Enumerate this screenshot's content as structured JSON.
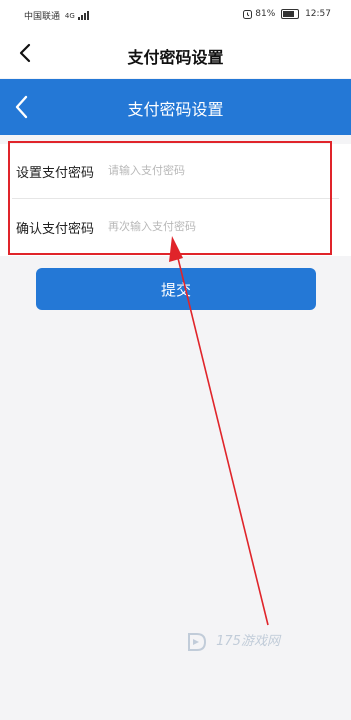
{
  "status_bar": {
    "carrier": "中国联通",
    "network": "4G",
    "battery": "81%",
    "time": "12:57"
  },
  "header": {
    "title": "支付密码设置"
  },
  "inner_header": {
    "title": "支付密码设置"
  },
  "form": {
    "set_password_label": "设置支付密码",
    "set_password_placeholder": "请输入支付密码",
    "confirm_password_label": "确认支付密码",
    "confirm_password_placeholder": "再次输入支付密码"
  },
  "submit_label": "提交",
  "watermark": "175游戏网",
  "colors": {
    "brand_blue": "#2478d6",
    "annotation_red": "#e0242a"
  }
}
